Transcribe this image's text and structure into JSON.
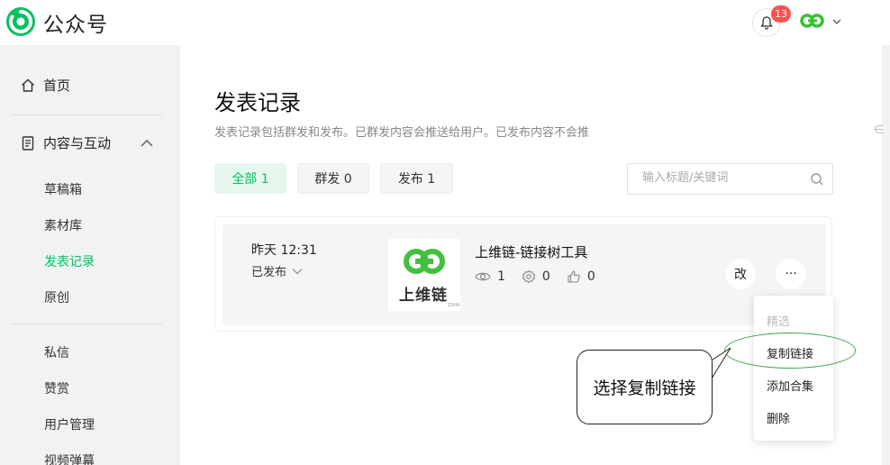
{
  "header": {
    "brand": "公众号",
    "notification_count": "13"
  },
  "sidebar": {
    "home": "首页",
    "section": "内容与互动",
    "items": [
      "草稿箱",
      "素材库",
      "发表记录",
      "原创"
    ],
    "items2": [
      "私信",
      "赞赏",
      "用户管理",
      "视频弹幕"
    ]
  },
  "main": {
    "title": "发表记录",
    "description": "发表记录包括群发和发布。已群发内容会推送给用户。已发布内容不会推",
    "tabs": [
      "全部 1",
      "群发 0",
      "发布 1"
    ],
    "search_placeholder": "输入标题/关键词",
    "record": {
      "time": "昨天 12:31",
      "status": "已发布",
      "thumb_text": "上维链",
      "thumb_small": "ZIXIA",
      "title": "上维链-链接树工具",
      "views": "1",
      "shares": "0",
      "likes": "0",
      "edit_label": "改",
      "more_label": "···"
    },
    "edge_glyph": "∈"
  },
  "dropdown": {
    "items": [
      "精选",
      "复制链接",
      "添加合集",
      "删除"
    ]
  },
  "callout": {
    "text": "选择复制链接"
  },
  "colors": {
    "brand_green": "#07c160",
    "badge_red": "#fa5151",
    "ellipse_green": "#3aa64a"
  }
}
